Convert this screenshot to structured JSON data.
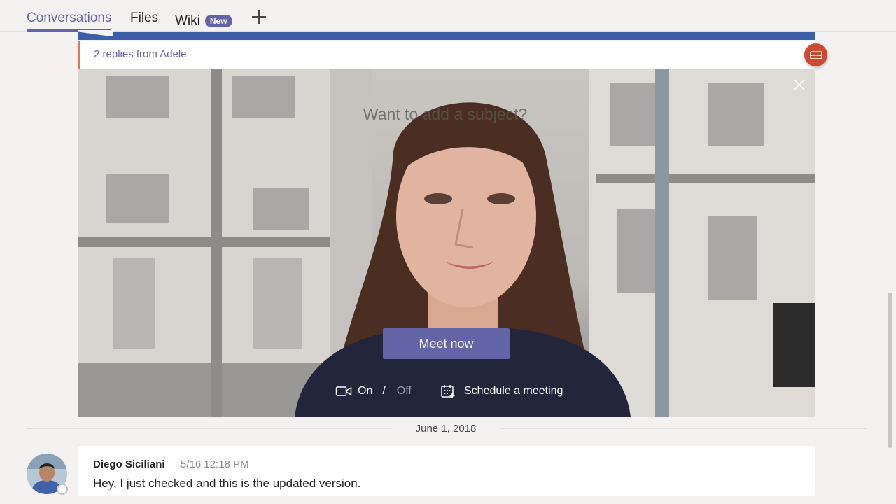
{
  "tabs": {
    "conversations": "Conversations",
    "files": "Files",
    "wiki": "Wiki",
    "wiki_badge": "New"
  },
  "thread": {
    "replies": "2 replies from Adele"
  },
  "meeting": {
    "subject_placeholder": "Want to add a subject?",
    "meet_now": "Meet now",
    "video_on": "On",
    "separator": "/",
    "video_off": "Off",
    "schedule": "Schedule a meeting"
  },
  "date_divider": "June 1, 2018",
  "message": {
    "author": "Diego Siciliani",
    "time": "5/16 12:18 PM",
    "body": "Hey, I just checked and this is the updated version."
  },
  "colors": {
    "accent": "#6264a7",
    "thread_top": "#3c5ea8",
    "reply_marker": "#e97548",
    "meeting_fab": "#cc4a31"
  }
}
